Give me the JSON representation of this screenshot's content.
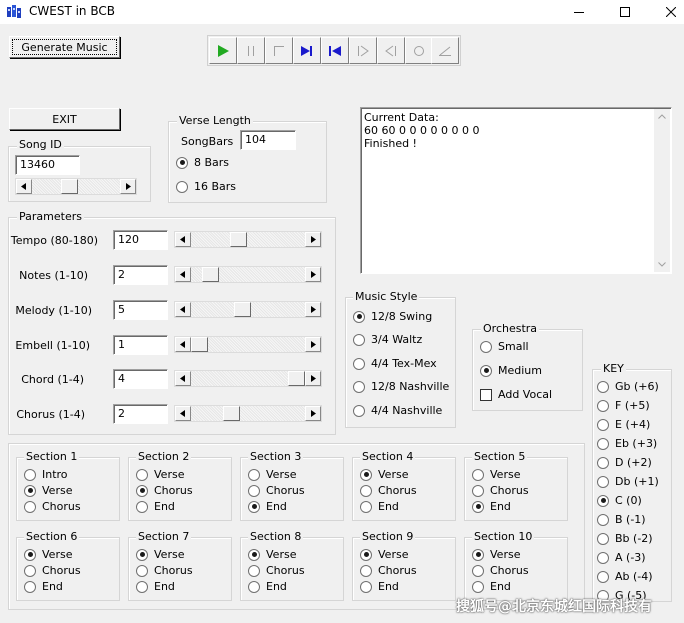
{
  "window": {
    "title": "CWEST in BCB",
    "controls": {
      "minimize": "minimize-icon",
      "maximize": "maximize-icon",
      "close": "close-icon"
    }
  },
  "buttons": {
    "generate": "Generate Music",
    "exit": "EXIT"
  },
  "transport": {
    "icons": [
      "play-icon",
      "pause-icon",
      "stop-icon",
      "next-track-icon",
      "previous-track-icon",
      "step-forward-icon",
      "step-back-icon",
      "record-icon",
      "eject-icon"
    ],
    "colors": {
      "play": "#22aa22",
      "skip": "#1a1acc",
      "disabled": "#a0a0a0"
    }
  },
  "song_id": {
    "legend": "Song ID",
    "value": "13460",
    "slider_level": 0.22
  },
  "verse_length": {
    "legend": "Verse Length",
    "songbars_label": "SongBars",
    "songbars_value": "104",
    "options": [
      {
        "label": "8 Bars",
        "selected": true
      },
      {
        "label": "16 Bars",
        "selected": false
      }
    ]
  },
  "parameters": {
    "legend": "Parameters",
    "rows": [
      {
        "label": "Tempo (80-180)",
        "value": "120",
        "level": 0.4
      },
      {
        "label": "Notes (1-10)",
        "value": "2",
        "level": 0.11
      },
      {
        "label": "Melody (1-10)",
        "value": "5",
        "level": 0.44
      },
      {
        "label": "Embell (1-10)",
        "value": "1",
        "level": 0.0
      },
      {
        "label": "Chord (1-4)",
        "value": "4",
        "level": 1.0
      },
      {
        "label": "Chorus (1-4)",
        "value": "2",
        "level": 0.33
      }
    ]
  },
  "memo": {
    "lines": [
      "Current Data:",
      "60 60 0 0 0 0 0 0 0 0",
      "Finished !"
    ]
  },
  "music_style": {
    "legend": "Music Style",
    "options": [
      {
        "label": "12/8 Swing",
        "selected": true
      },
      {
        "label": "3/4 Waltz",
        "selected": false
      },
      {
        "label": "4/4 Tex-Mex",
        "selected": false
      },
      {
        "label": "12/8 Nashville",
        "selected": false
      },
      {
        "label": "4/4 Nashville",
        "selected": false
      }
    ]
  },
  "orchestra": {
    "legend": "Orchestra",
    "options": [
      {
        "label": "Small",
        "selected": false
      },
      {
        "label": "Medium",
        "selected": true
      }
    ],
    "vocal": {
      "label": "Add Vocal",
      "checked": false
    }
  },
  "key": {
    "legend": "KEY",
    "options": [
      {
        "label": "Gb (+6)",
        "selected": false
      },
      {
        "label": "F (+5)",
        "selected": false
      },
      {
        "label": "E (+4)",
        "selected": false
      },
      {
        "label": "Eb (+3)",
        "selected": false
      },
      {
        "label": "D (+2)",
        "selected": false
      },
      {
        "label": "Db (+1)",
        "selected": false
      },
      {
        "label": "C (0)",
        "selected": true
      },
      {
        "label": "B (-1)",
        "selected": false
      },
      {
        "label": "Bb (-2)",
        "selected": false
      },
      {
        "label": "A (-3)",
        "selected": false
      },
      {
        "label": "Ab (-4)",
        "selected": false
      },
      {
        "label": "G (-5)",
        "selected": false
      }
    ]
  },
  "sections": [
    {
      "title": "Section 1",
      "options": [
        "Intro",
        "Verse",
        "Chorus"
      ],
      "selected": 1
    },
    {
      "title": "Section 2",
      "options": [
        "Verse",
        "Chorus",
        "End"
      ],
      "selected": 1
    },
    {
      "title": "Section 3",
      "options": [
        "Verse",
        "Chorus",
        "End"
      ],
      "selected": 2
    },
    {
      "title": "Section 4",
      "options": [
        "Verse",
        "Chorus",
        "End"
      ],
      "selected": 0
    },
    {
      "title": "Section 5",
      "options": [
        "Verse",
        "Chorus",
        "End"
      ],
      "selected": 2
    },
    {
      "title": "Section 6",
      "options": [
        "Verse",
        "Chorus",
        "End"
      ],
      "selected": 0
    },
    {
      "title": "Section 7",
      "options": [
        "Verse",
        "Chorus",
        "End"
      ],
      "selected": 0
    },
    {
      "title": "Section 8",
      "options": [
        "Verse",
        "Chorus",
        "End"
      ],
      "selected": 0
    },
    {
      "title": "Section 9",
      "options": [
        "Verse",
        "Chorus",
        "End"
      ],
      "selected": 0
    },
    {
      "title": "Section 10",
      "options": [
        "Verse",
        "Chorus",
        "End"
      ],
      "selected": 0
    }
  ],
  "watermark": "搜狐号@北京东城红国际科技有"
}
